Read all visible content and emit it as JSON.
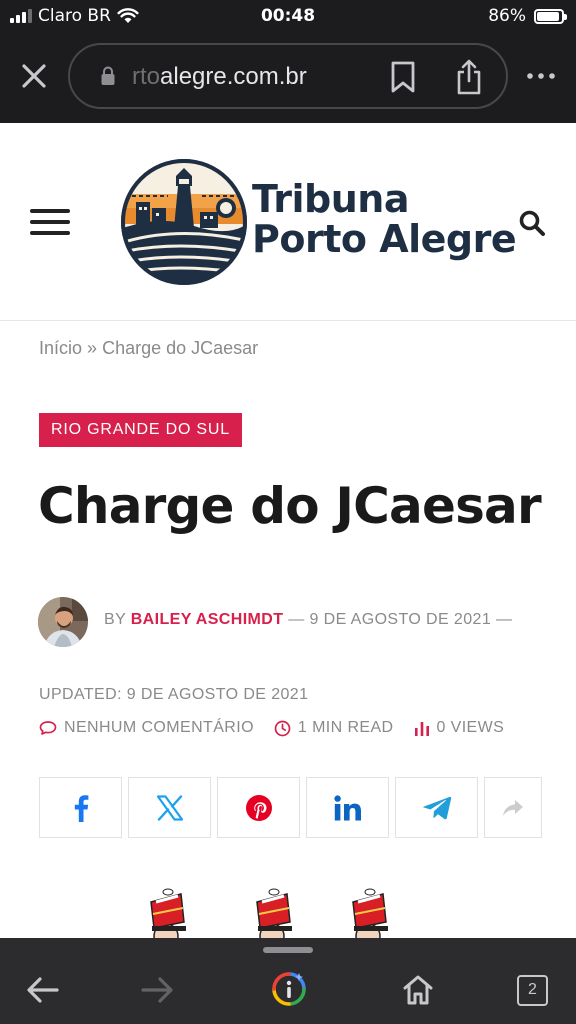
{
  "status_bar": {
    "carrier": "Claro BR",
    "time": "00:48",
    "battery_percent": "86%",
    "battery_level": 0.86
  },
  "browser": {
    "url_faded": "rto",
    "url_main": "alegre.com.br",
    "tab_count": "2",
    "icons": [
      "close-icon",
      "lock-icon",
      "bookmark-icon",
      "share-icon",
      "more-icon",
      "back-icon",
      "forward-icon",
      "assistant-icon",
      "home-icon",
      "tabs-icon"
    ]
  },
  "site": {
    "logo_line1": "Tribuna",
    "logo_line2": "Porto Alegre",
    "brand_color": "#1e2f44",
    "accent_color": "#d8204c",
    "icons": [
      "hamburger-menu-icon",
      "search-icon"
    ]
  },
  "breadcrumb": {
    "home": "Início",
    "separator": "»",
    "current": "Charge do JCaesar"
  },
  "article": {
    "category": "RIO GRANDE DO SUL",
    "title": "Charge do JCaesar",
    "by_label": "BY",
    "author": "BAILEY ASCHIMDT",
    "dash": "—",
    "date": "9 DE AGOSTO DE 2021",
    "updated_label": "UPDATED:",
    "updated_date": "9 DE AGOSTO DE 2021",
    "comments": "NENHUM COMENTÁRIO",
    "read_time": "1 MIN READ",
    "views": "0 VIEWS"
  },
  "share": {
    "networks": [
      "facebook",
      "x",
      "pinterest",
      "linkedin",
      "telegram",
      "more"
    ],
    "colors": {
      "facebook": "#1877f2",
      "x": "#1da1f2",
      "pinterest": "#e60023",
      "linkedin": "#0a66c2",
      "telegram": "#229ed9",
      "more": "#cccccc"
    }
  }
}
